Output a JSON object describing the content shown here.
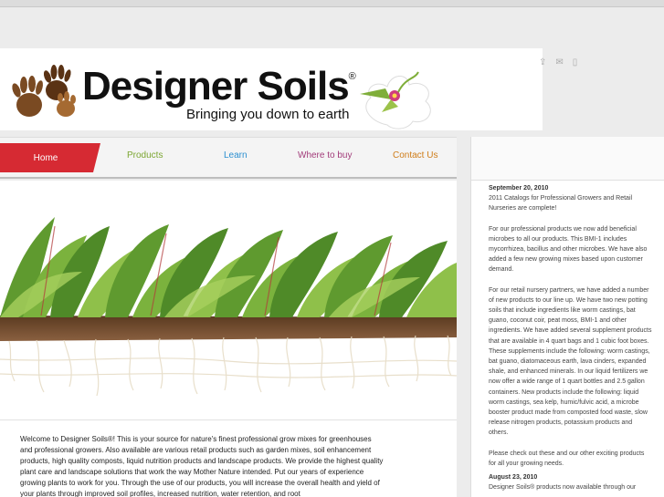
{
  "header": {
    "brand_name": "Designer Soils",
    "registered_mark": "®",
    "tagline": "Bringing you down to earth",
    "icons": [
      "share-icon",
      "mail-icon",
      "print-icon"
    ]
  },
  "nav": {
    "items": [
      {
        "label": "Home",
        "color": "#d62a33",
        "active": true
      },
      {
        "label": "Products",
        "color": "#7ca632"
      },
      {
        "label": "Learn",
        "color": "#2b8fd0"
      },
      {
        "label": "Where to buy",
        "color": "#a23c7a"
      },
      {
        "label": "Contact Us",
        "color": "#cf7d19"
      }
    ]
  },
  "intro": {
    "text": "Welcome to Designer Soils®! This is your source for nature's finest professional grow mixes for greenhouses and professional growers. Also available are various retail products such as garden mixes, soil enhancement products, high quality composts, liquid nutrition products and landscape products. We provide the highest quality plant care and landscape solutions that work the way Mother Nature intended. Put our years of experience growing plants to work for you. Through the use of our products, you will increase the overall health and yield of your plants through improved soil profiles, increased nutrition, water retention, and root"
  },
  "news": {
    "items": [
      {
        "date": "September 20, 2010",
        "paragraphs": [
          "2011 Catalogs for Professional Growers and Retail Nurseries are complete!",
          "For our professional products we now add beneficial microbes to all our products. This BMI-1 includes mycorrhizea, bacillus and other microbes. We have also added a few new growing mixes based upon customer demand.",
          "For our retail nursery partners, we have added a number of new products to our line up. We have two new potting soils that include ingredients like worm castings, bat guano, coconut coir, peat moss, BMI-1 and other ingredients. We have added several supplement products that are available in 4 quart bags and 1 cubic foot boxes. These supplements include the following: worm castings, bat guano, diatomaceous earth, lava cinders, expanded shale, and enhanced minerals. In our liquid fertilizers we now offer a wide range of 1 quart bottles and 2.5 gallon containers. New products include the following: liquid worm castings, sea kelp, humic/fulvic acid, a microbe booster product made from composted food waste, slow release nitrogen products, potassium products and others.",
          "Please check out these and our other exciting products for all your growing needs."
        ]
      },
      {
        "date": "August 23, 2010",
        "paragraphs": [
          "Designer Soils® products now available through our"
        ]
      }
    ]
  }
}
